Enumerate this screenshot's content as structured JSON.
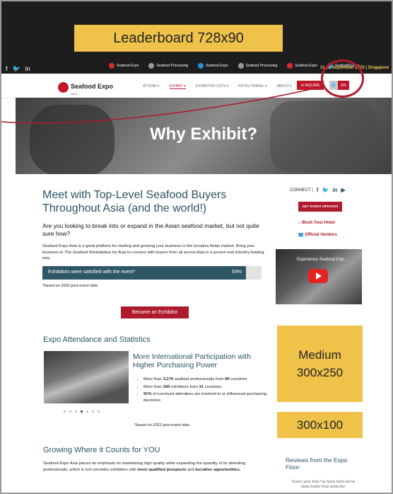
{
  "ad_leaderboard": "Leaderboard 728x90",
  "topbar": {
    "social": [
      "f",
      "🐦",
      "in"
    ],
    "logos": [
      {
        "name": "Seafood Expo",
        "color": "#d62b2b"
      },
      {
        "name": "Seafood Processing",
        "color": "#9a9a9a"
      },
      {
        "name": "Seafood Expo",
        "color": "#2e8bd6"
      },
      {
        "name": "Seafood Processing",
        "color": "#9a9a9a"
      },
      {
        "name": "Seafood Expo",
        "color": "#d62b2b"
      },
      {
        "name": "SeafoodSource",
        "color": "#2e8bd6"
      }
    ],
    "dates": "11-13 September 2023 | Singapore"
  },
  "nav": {
    "brand": "Seafood Expo",
    "brand_sub": "ASIA",
    "items": [
      "ATTEND ▾",
      "EXHIBIT ▾",
      "EXHIBITOR LISTS ▾",
      "HOTEL/TRAVEL ▾",
      "ABOUT ▾",
      "🔍"
    ],
    "inquire": "✉ INQUIRE",
    "lang_a": "🌐",
    "lang_b": "EN"
  },
  "hero": {
    "title": "Why Exhibit?"
  },
  "main": {
    "heading": "Meet with Top-Level Seafood Buyers Throughout Asia (and the world!)",
    "lead": "Are you looking to break into or expand in the Asian seafood market, but not quite sure how?",
    "para1_a": "Seafood Expo Asia is a great platform for starting and growing your business in the lucrative Asian market. Bring your business to ",
    "para1_em": "The Seafood Marketplace for Asia",
    "para1_b": " to connect with buyers from all across Asia in a proven and industry-leading way:",
    "stat_label": "Exhibitors were satisfied with the event*",
    "stat_value": "93%",
    "stat_fraction": 0.93,
    "note": "*based on 2022 post-event data",
    "cta": "Become an Exhibitor"
  },
  "stats": {
    "heading": "Expo Attendance and Statistics",
    "subheading": "More International Participation with Higher Purchasing Power",
    "b1_a": "More than ",
    "b1_b": "3,170",
    "b1_c": " seafood professionals from ",
    "b1_d": "69",
    "b1_e": " countries",
    "b2_a": "More than ",
    "b2_b": "200",
    "b2_c": " exhibitors from ",
    "b2_d": "31",
    "b2_e": " countries",
    "b3_a": "91%",
    "b3_b": " of surveyed attendees are involved in or influenced purchasing decisions",
    "note": "*based on 2022 post-event data"
  },
  "growing": {
    "heading": "Growing Where it Counts for YOU",
    "para_a": "Seafood Expo Asia places an emphasis on maintaining high quality while expanding the quantity of its attending professionals, which in turn provides exhibitors with ",
    "para_b": "more qualified prospects",
    "para_c": " and ",
    "para_d": "lucrative opportunities."
  },
  "sidebar": {
    "connect": "CONNECT |",
    "updates": "GET EVENT UPDATES",
    "book": "Book Your Hotel",
    "vendors": "Official Vendors",
    "video_title": "Experience Seafood Exp...",
    "ad_medium_1": "Medium",
    "ad_medium_2": "300x250",
    "ad_small": "300x100",
    "reviews_heading": "Reviews from the Expo Floor:",
    "quote": "\"Every year that I've been here we've done better than what the"
  }
}
